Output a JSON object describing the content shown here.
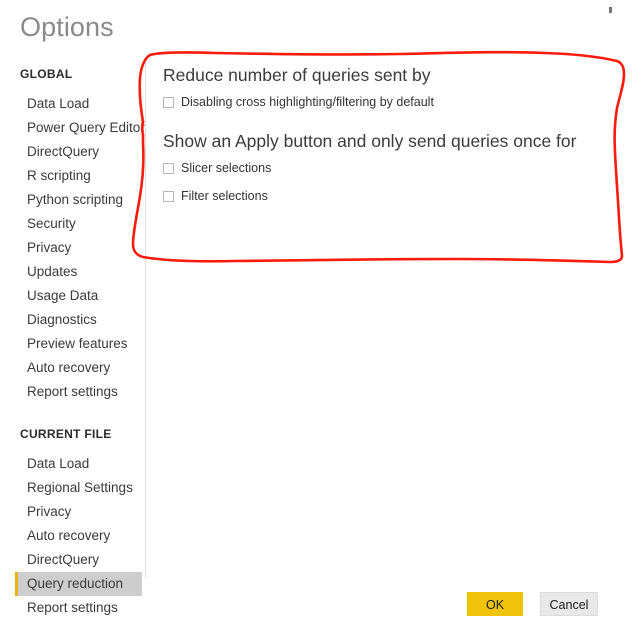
{
  "dialog": {
    "title": "Options"
  },
  "sidebar": {
    "groups": [
      {
        "label": "GLOBAL",
        "items": [
          {
            "label": "Data Load",
            "selected": false
          },
          {
            "label": "Power Query Editor",
            "selected": false
          },
          {
            "label": "DirectQuery",
            "selected": false
          },
          {
            "label": "R scripting",
            "selected": false
          },
          {
            "label": "Python scripting",
            "selected": false
          },
          {
            "label": "Security",
            "selected": false
          },
          {
            "label": "Privacy",
            "selected": false
          },
          {
            "label": "Updates",
            "selected": false
          },
          {
            "label": "Usage Data",
            "selected": false
          },
          {
            "label": "Diagnostics",
            "selected": false
          },
          {
            "label": "Preview features",
            "selected": false
          },
          {
            "label": "Auto recovery",
            "selected": false
          },
          {
            "label": "Report settings",
            "selected": false
          }
        ]
      },
      {
        "label": "CURRENT FILE",
        "items": [
          {
            "label": "Data Load",
            "selected": false
          },
          {
            "label": "Regional Settings",
            "selected": false
          },
          {
            "label": "Privacy",
            "selected": false
          },
          {
            "label": "Auto recovery",
            "selected": false
          },
          {
            "label": "DirectQuery",
            "selected": false
          },
          {
            "label": "Query reduction",
            "selected": true
          },
          {
            "label": "Report settings",
            "selected": false
          }
        ]
      }
    ]
  },
  "content": {
    "sections": [
      {
        "heading": "Reduce number of queries sent by",
        "options": [
          {
            "label": "Disabling cross highlighting/filtering by default",
            "checked": false
          }
        ]
      },
      {
        "heading": "Show an Apply button and only send queries once for",
        "options": [
          {
            "label": "Slicer selections",
            "checked": false
          },
          {
            "label": "Filter selections",
            "checked": false
          }
        ]
      }
    ]
  },
  "footer": {
    "ok_label": "OK",
    "cancel_label": "Cancel"
  },
  "colors": {
    "accent_yellow": "#efc40b",
    "selected_row_bg": "#cdcdcd",
    "annotation_red": "#f91c0c",
    "cancel_bg": "#e8e8e8",
    "title_gray": "#8a8a8a"
  },
  "annotation": {
    "shape": "hand-drawn-red-rectangle",
    "encloses": "query-reduction-settings-panel"
  }
}
